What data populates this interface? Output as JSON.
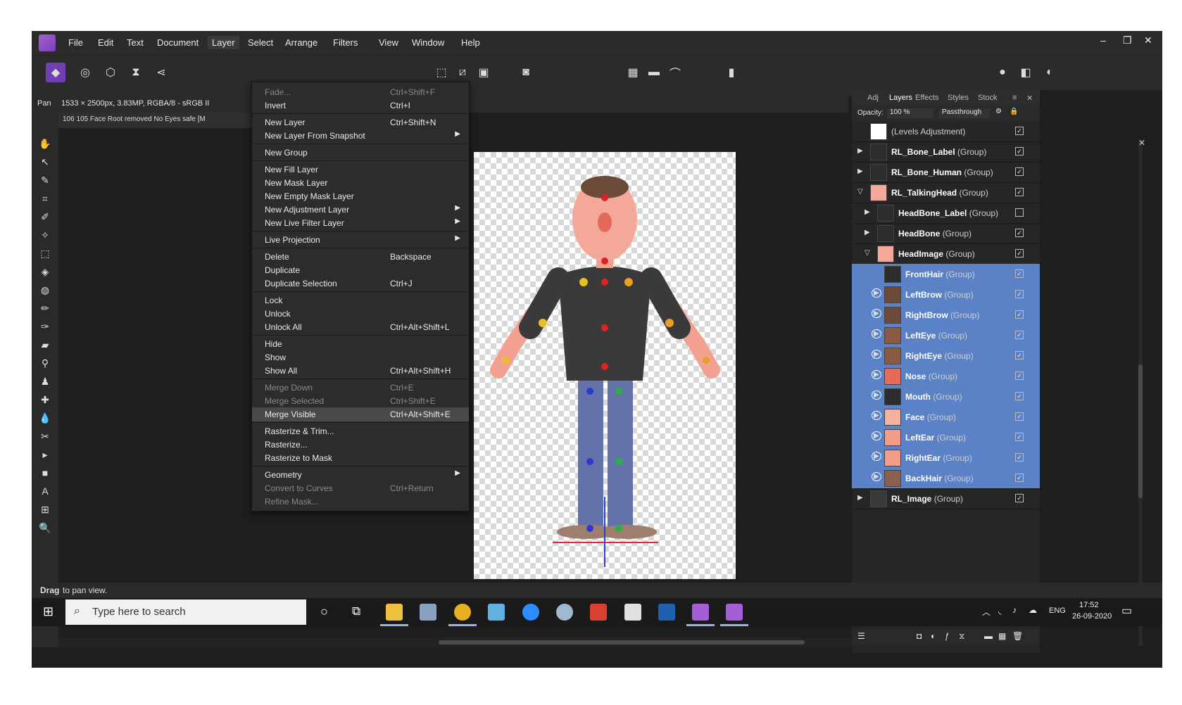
{
  "menubar": {
    "items": [
      "File",
      "Edit",
      "Text",
      "Document",
      "Layer",
      "Select",
      "Arrange",
      "Filters",
      "View",
      "Window",
      "Help"
    ],
    "open_item": "Layer"
  },
  "context": {
    "tool": "Pan",
    "info": "1533 × 2500px, 3.83MP, RGBA/8 - sRGB II"
  },
  "document_tab": "106 105 Face Root removed No Eyes safe [M",
  "layer_menu": [
    {
      "label": "Fade...",
      "shortcut": "Ctrl+Shift+F",
      "disabled": true
    },
    {
      "label": "Invert",
      "shortcut": "Ctrl+I"
    },
    {
      "sep": true
    },
    {
      "label": "New Layer",
      "shortcut": "Ctrl+Shift+N"
    },
    {
      "label": "New Layer From Snapshot",
      "submenu": true
    },
    {
      "sep": true
    },
    {
      "label": "New Group"
    },
    {
      "sep": true
    },
    {
      "label": "New Fill Layer"
    },
    {
      "label": "New Mask Layer"
    },
    {
      "label": "New Empty Mask Layer"
    },
    {
      "label": "New Adjustment Layer",
      "submenu": true
    },
    {
      "label": "New Live Filter Layer",
      "submenu": true
    },
    {
      "sep": true
    },
    {
      "label": "Live Projection",
      "submenu": true
    },
    {
      "sep": true
    },
    {
      "label": "Delete",
      "shortcut": "Backspace"
    },
    {
      "label": "Duplicate"
    },
    {
      "label": "Duplicate Selection",
      "shortcut": "Ctrl+J"
    },
    {
      "sep": true
    },
    {
      "label": "Lock"
    },
    {
      "label": "Unlock"
    },
    {
      "label": "Unlock All",
      "shortcut": "Ctrl+Alt+Shift+L"
    },
    {
      "sep": true
    },
    {
      "label": "Hide"
    },
    {
      "label": "Show"
    },
    {
      "label": "Show All",
      "shortcut": "Ctrl+Alt+Shift+H"
    },
    {
      "sep": true
    },
    {
      "label": "Merge Down",
      "shortcut": "Ctrl+E",
      "disabled": true
    },
    {
      "label": "Merge Selected",
      "shortcut": "Ctrl+Shift+E",
      "disabled": true
    },
    {
      "label": "Merge Visible",
      "shortcut": "Ctrl+Alt+Shift+E",
      "highlighted": true
    },
    {
      "sep": true
    },
    {
      "label": "Rasterize & Trim..."
    },
    {
      "label": "Rasterize..."
    },
    {
      "label": "Rasterize to Mask"
    },
    {
      "sep": true
    },
    {
      "label": "Geometry",
      "submenu": true
    },
    {
      "label": "Convert to Curves",
      "shortcut": "Ctrl+Return",
      "disabled": true
    },
    {
      "label": "Refine Mask...",
      "disabled": true
    }
  ],
  "panel": {
    "tabs": [
      "Adj",
      "Layers",
      "Effects",
      "Styles",
      "Stock"
    ],
    "active_tab": "Layers",
    "opacity_label": "Opacity:",
    "opacity_value": "100 %",
    "blend_mode": "Passthrough",
    "layers": [
      {
        "name": "",
        "type": "(Levels Adjustment)",
        "indent": 0,
        "expander": "none",
        "checked": true,
        "selected": false,
        "thumb": "#ffffff"
      },
      {
        "name": "RL_Bone_Label",
        "type": "(Group)",
        "indent": 0,
        "expander": "arrow",
        "checked": true,
        "selected": false,
        "thumb": "#2d2d2d"
      },
      {
        "name": "RL_Bone_Human",
        "type": "(Group)",
        "indent": 0,
        "expander": "arrow",
        "checked": true,
        "selected": false,
        "thumb": "#2d2d2d"
      },
      {
        "name": "RL_TalkingHead",
        "type": "(Group)",
        "indent": 0,
        "expander": "open",
        "checked": true,
        "selected": false,
        "thumb": "#f4a89a"
      },
      {
        "name": "HeadBone_Label",
        "type": "(Group)",
        "indent": 1,
        "expander": "arrow",
        "checked": false,
        "selected": false,
        "thumb": "#2d2d2d"
      },
      {
        "name": "HeadBone",
        "type": "(Group)",
        "indent": 1,
        "expander": "arrow",
        "checked": true,
        "selected": false,
        "thumb": "#2d2d2d"
      },
      {
        "name": "HeadImage",
        "type": "(Group)",
        "indent": 1,
        "expander": "open",
        "checked": true,
        "selected": false,
        "thumb": "#f4a89a"
      },
      {
        "name": "FrontHair",
        "type": "(Group)",
        "indent": 2,
        "expander": "none",
        "checked": true,
        "selected": true,
        "thumb": "#2d2d2d"
      },
      {
        "name": "LeftBrow",
        "type": "(Group)",
        "indent": 2,
        "expander": "circle",
        "checked": true,
        "selected": true,
        "thumb": "#6b4a3a"
      },
      {
        "name": "RightBrow",
        "type": "(Group)",
        "indent": 2,
        "expander": "circle",
        "checked": true,
        "selected": true,
        "thumb": "#6b4a3a"
      },
      {
        "name": "LeftEye",
        "type": "(Group)",
        "indent": 2,
        "expander": "circle",
        "checked": true,
        "selected": true,
        "thumb": "#8a5a44"
      },
      {
        "name": "RightEye",
        "type": "(Group)",
        "indent": 2,
        "expander": "circle",
        "checked": true,
        "selected": true,
        "thumb": "#8a5a44"
      },
      {
        "name": "Nose",
        "type": "(Group)",
        "indent": 2,
        "expander": "circle",
        "checked": true,
        "selected": true,
        "thumb": "#e46a5a"
      },
      {
        "name": "Mouth",
        "type": "(Group)",
        "indent": 2,
        "expander": "circle",
        "checked": true,
        "selected": true,
        "thumb": "#2d2d2d"
      },
      {
        "name": "Face",
        "type": "(Group)",
        "indent": 2,
        "expander": "circle",
        "checked": true,
        "selected": true,
        "thumb": "#f4b0a0"
      },
      {
        "name": "LeftEar",
        "type": "(Group)",
        "indent": 2,
        "expander": "circle",
        "checked": true,
        "selected": true,
        "thumb": "#f49c8a"
      },
      {
        "name": "RightEar",
        "type": "(Group)",
        "indent": 2,
        "expander": "circle",
        "checked": true,
        "selected": true,
        "thumb": "#f49c8a"
      },
      {
        "name": "BackHair",
        "type": "(Group)",
        "indent": 2,
        "expander": "circle",
        "checked": true,
        "selected": true,
        "thumb": "#8a6050"
      },
      {
        "name": "RL_Image",
        "type": "(Group)",
        "indent": 0,
        "expander": "arrow",
        "checked": true,
        "selected": false,
        "thumb": "#3a3a3a"
      }
    ]
  },
  "status": {
    "bold": "Drag",
    "text": "to pan view."
  },
  "taskbar": {
    "search_placeholder": "Type here to search",
    "lang": "ENG",
    "time": "17:52",
    "date": "26-09-2020"
  },
  "colors": {
    "accent": "#6f3fb3",
    "selection": "#5b82c6"
  }
}
